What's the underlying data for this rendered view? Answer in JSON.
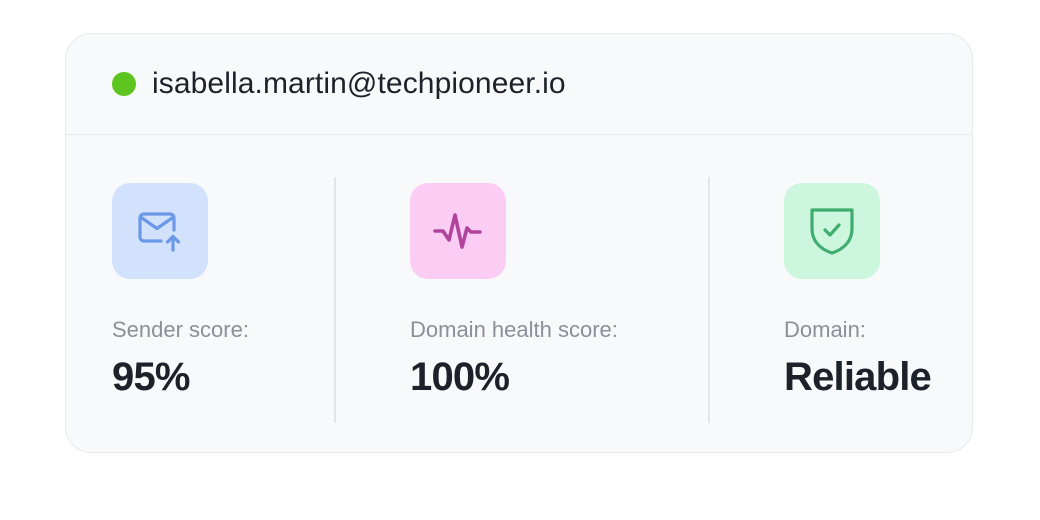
{
  "account": {
    "email": "isabella.martin@techpioneer.io",
    "status_color": "#5ec520"
  },
  "metrics": [
    {
      "icon": "mail-upload-icon",
      "icon_bg": "#d3e2fc",
      "icon_color": "#6b98e9",
      "label": "Sender score:",
      "value": "95%"
    },
    {
      "icon": "activity-pulse-icon",
      "icon_bg": "#fccdf4",
      "icon_color": "#b0449d",
      "label": "Domain health score:",
      "value": "100%"
    },
    {
      "icon": "shield-check-icon",
      "icon_bg": "#cdf6df",
      "icon_color": "#3fad6e",
      "label": "Domain:",
      "value": "Reliable"
    }
  ]
}
